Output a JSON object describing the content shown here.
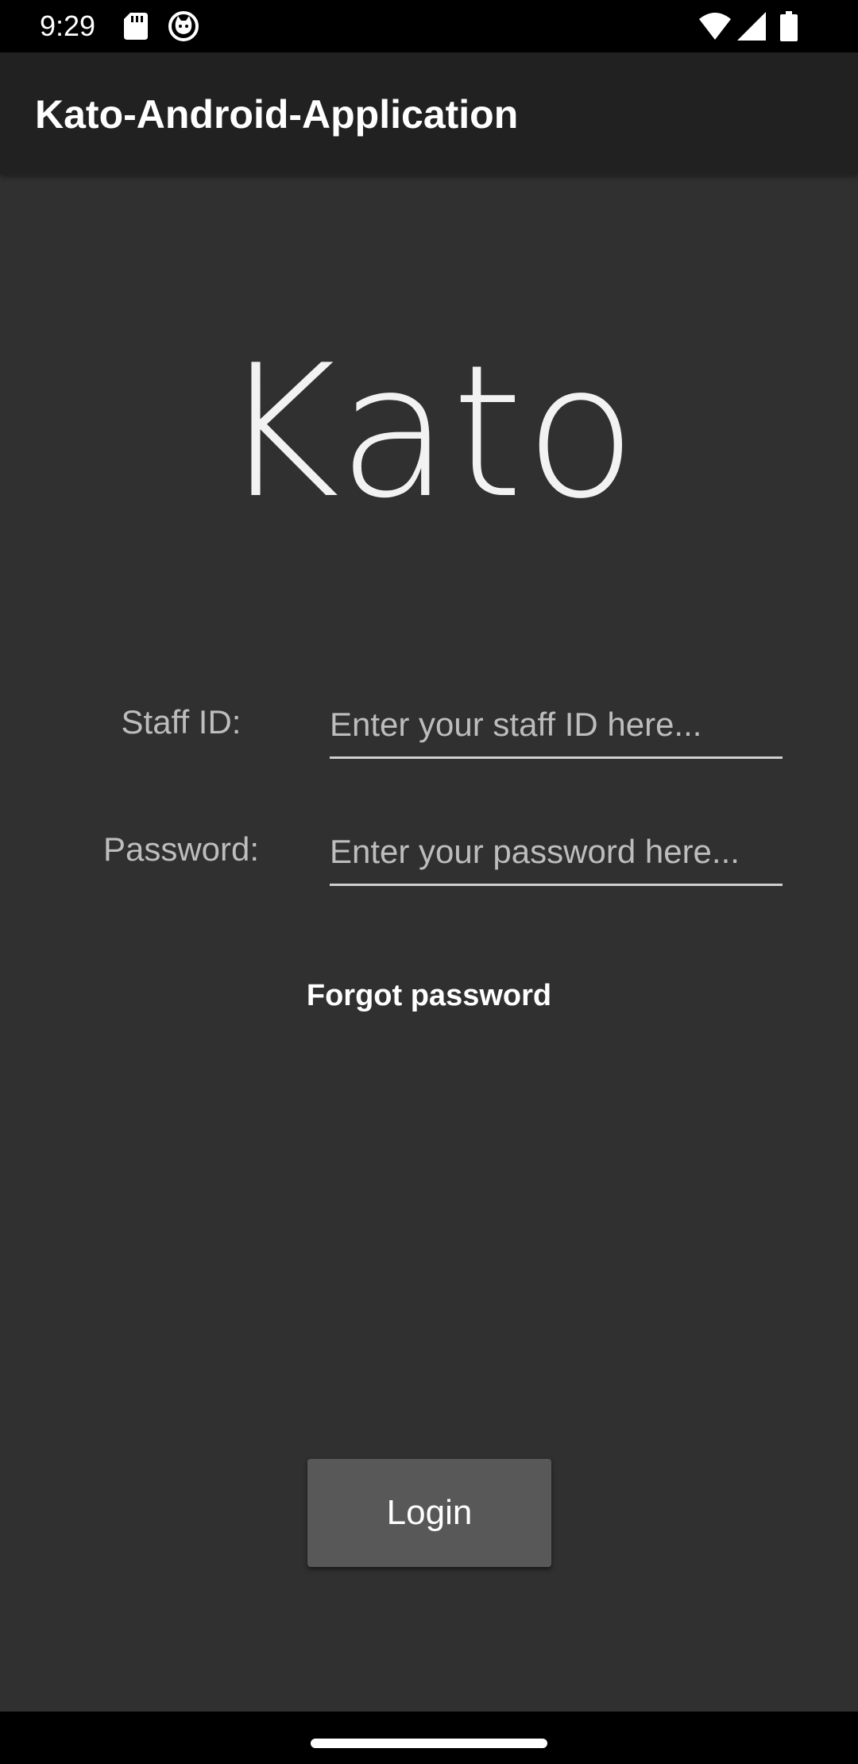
{
  "status_bar": {
    "time": "9:29",
    "icons": [
      "sd-card-icon",
      "cat-icon",
      "wifi-icon",
      "signal-icon",
      "battery-icon"
    ]
  },
  "app_bar": {
    "title": "Kato-Android-Application"
  },
  "logo": {
    "text": "Kato"
  },
  "form": {
    "staff_id_label": "Staff ID:",
    "staff_id_placeholder": "Enter your staff ID here...",
    "staff_id_value": "",
    "password_label": "Password:",
    "password_placeholder": "Enter your password here...",
    "password_value": "",
    "forgot_password": "Forgot password",
    "login_label": "Login"
  },
  "colors": {
    "background": "#303030",
    "app_bar": "#212121",
    "button": "#585858",
    "text": "#ffffff",
    "label": "#bdbdbd"
  }
}
